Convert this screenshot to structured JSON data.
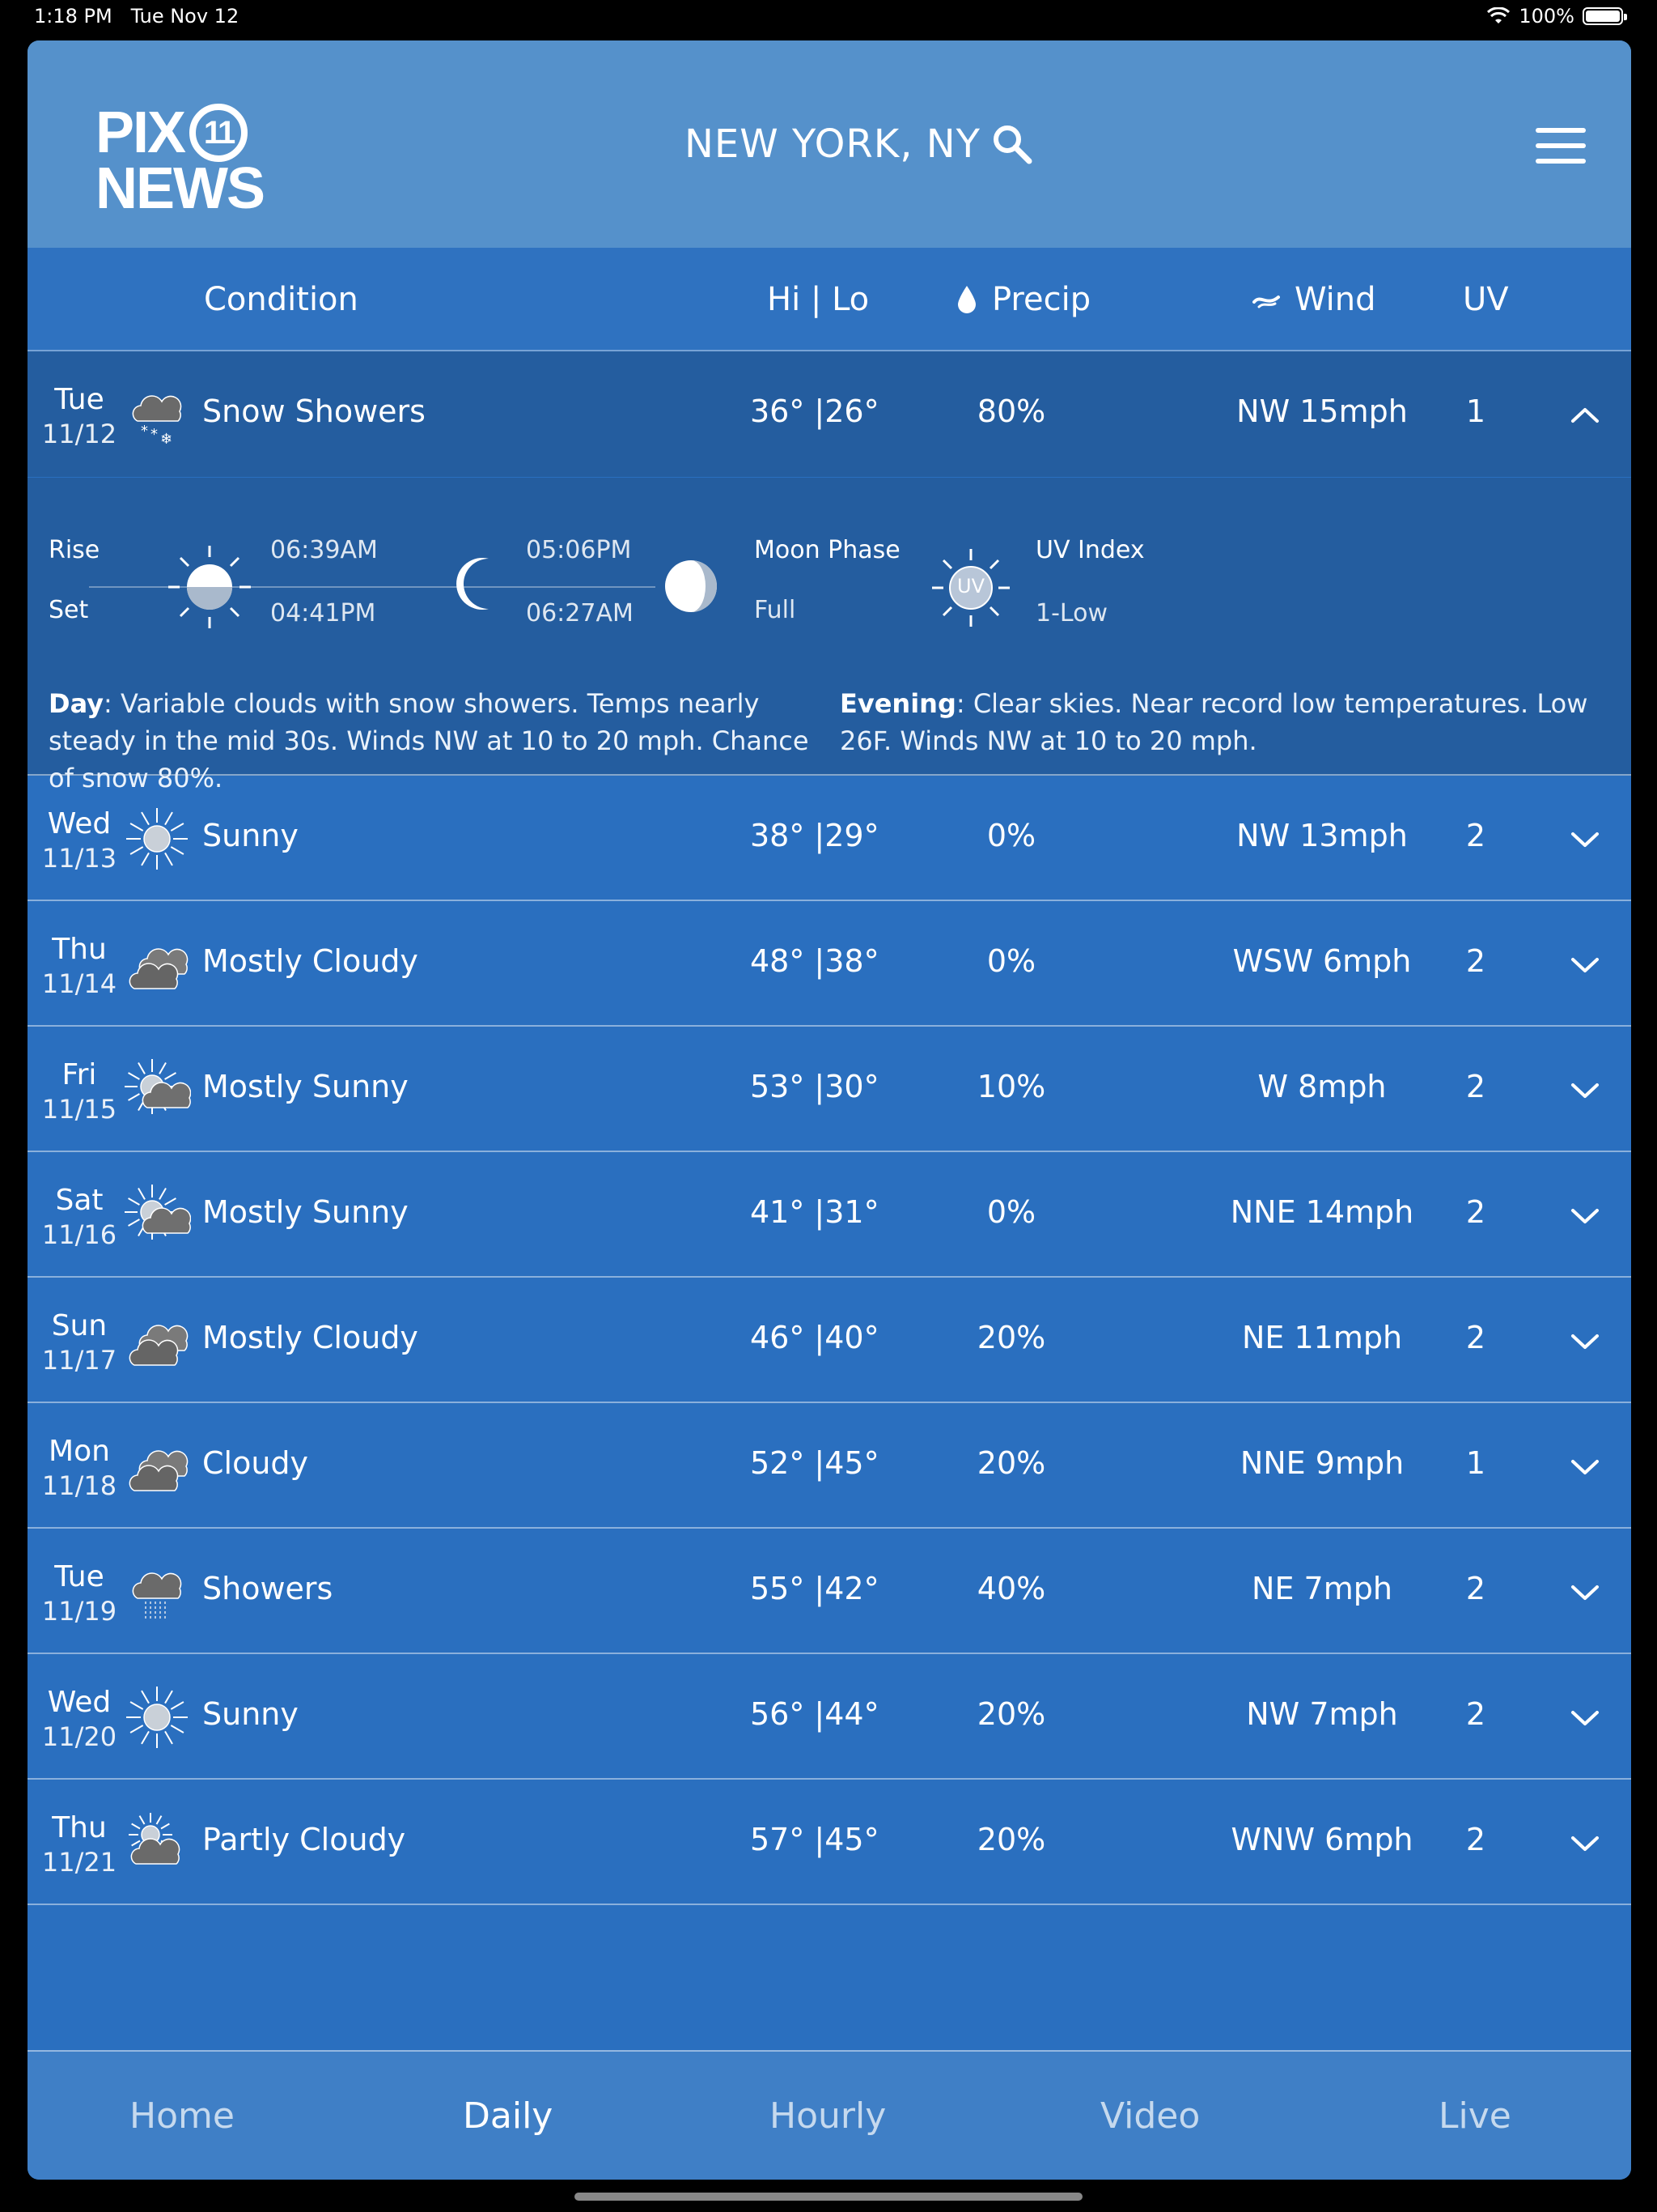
{
  "status": {
    "time": "1:18 PM",
    "date": "Tue Nov 12",
    "battery": "100%"
  },
  "header": {
    "logo_line1": "PIX",
    "logo_ring": "11",
    "logo_line2": "NEWS",
    "location": "NEW YORK, NY"
  },
  "columns": {
    "condition": "Condition",
    "hilo": "Hi | Lo",
    "precip": "Precip",
    "wind": "Wind",
    "uv": "UV"
  },
  "rows": [
    {
      "day": "Tue",
      "date": "11/12",
      "icon": "snow-showers-icon",
      "condition": "Snow Showers",
      "hilo": "36° |26°",
      "precip": "80%",
      "wind": "NW 15mph",
      "uv": "1"
    },
    {
      "day": "Wed",
      "date": "11/13",
      "icon": "sunny-icon",
      "condition": "Sunny",
      "hilo": "38° |29°",
      "precip": "0%",
      "wind": "NW 13mph",
      "uv": "2"
    },
    {
      "day": "Thu",
      "date": "11/14",
      "icon": "mostly-cloudy-icon",
      "condition": "Mostly Cloudy",
      "hilo": "48° |38°",
      "precip": "0%",
      "wind": "WSW 6mph",
      "uv": "2"
    },
    {
      "day": "Fri",
      "date": "11/15",
      "icon": "mostly-sunny-icon",
      "condition": "Mostly Sunny",
      "hilo": "53° |30°",
      "precip": "10%",
      "wind": "W 8mph",
      "uv": "2"
    },
    {
      "day": "Sat",
      "date": "11/16",
      "icon": "mostly-sunny-icon",
      "condition": "Mostly Sunny",
      "hilo": "41° |31°",
      "precip": "0%",
      "wind": "NNE 14mph",
      "uv": "2"
    },
    {
      "day": "Sun",
      "date": "11/17",
      "icon": "mostly-cloudy-icon",
      "condition": "Mostly Cloudy",
      "hilo": "46° |40°",
      "precip": "20%",
      "wind": "NE 11mph",
      "uv": "2"
    },
    {
      "day": "Mon",
      "date": "11/18",
      "icon": "cloudy-icon",
      "condition": "Cloudy",
      "hilo": "52° |45°",
      "precip": "20%",
      "wind": "NNE 9mph",
      "uv": "1"
    },
    {
      "day": "Tue",
      "date": "11/19",
      "icon": "showers-icon",
      "condition": "Showers",
      "hilo": "55° |42°",
      "precip": "40%",
      "wind": "NE 7mph",
      "uv": "2"
    },
    {
      "day": "Wed",
      "date": "11/20",
      "icon": "sunny-icon",
      "condition": "Sunny",
      "hilo": "56° |44°",
      "precip": "20%",
      "wind": "NW 7mph",
      "uv": "2"
    },
    {
      "day": "Thu",
      "date": "11/21",
      "icon": "partly-cloudy-icon",
      "condition": "Partly Cloudy",
      "hilo": "57° |45°",
      "precip": "20%",
      "wind": "WNW 6mph",
      "uv": "2"
    }
  ],
  "detail": {
    "rise_label": "Rise",
    "set_label": "Set",
    "sunrise": "06:39AM",
    "sunset": "04:41PM",
    "moonrise": "05:06PM",
    "moonset": "06:27AM",
    "moon_phase_label": "Moon Phase",
    "moon_phase": "Full",
    "uv_badge": "UV",
    "uv_index_label": "UV Index",
    "uv_index": "1-Low",
    "day_label": "Day",
    "day_text": ": Variable clouds with snow showers. Temps nearly steady in the mid 30s. Winds NW at 10 to 20 mph. Chance of snow 80%.",
    "evening_label": "Evening",
    "evening_text": ": Clear skies. Near record low temperatures. Low 26F. Winds NW at 10 to 20 mph."
  },
  "nav": {
    "home": "Home",
    "daily": "Daily",
    "hourly": "Hourly",
    "video": "Video",
    "live": "Live"
  }
}
